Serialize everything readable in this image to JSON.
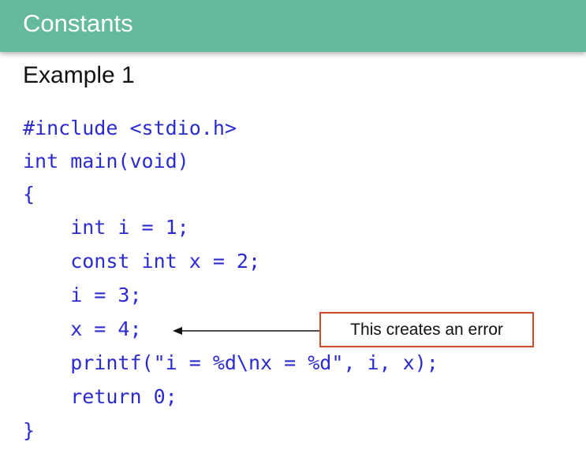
{
  "header": {
    "title": "Constants",
    "background_color": "#65b99d"
  },
  "subtitle": "Example 1",
  "code": {
    "color": "#2b2bd0",
    "lines": [
      "#include <stdio.h>",
      "int main(void)",
      "{",
      "    int i = 1;",
      "    const int x = 2;",
      "    i = 3;",
      "    x = 4;",
      "    printf(\"i = %d\\nx = %d\", i, x);",
      "    return 0;",
      "}"
    ]
  },
  "callout": {
    "text": "This creates an error",
    "border_color": "#cf4a2c",
    "arrow_icon": "arrow-left-icon"
  }
}
